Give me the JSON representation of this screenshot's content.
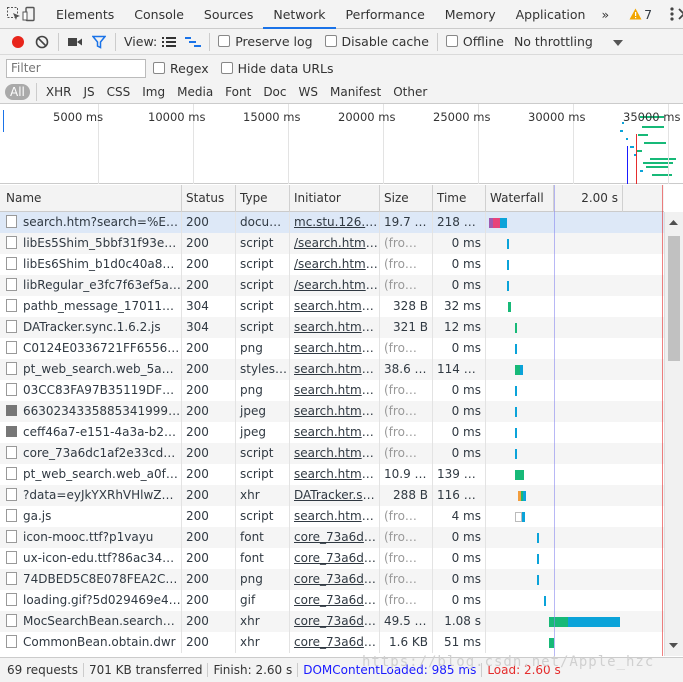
{
  "tabs": {
    "items": [
      "Elements",
      "Console",
      "Sources",
      "Network",
      "Performance",
      "Memory",
      "Application"
    ],
    "more": "»",
    "warnings": "7"
  },
  "toolbar": {
    "view_label": "View:",
    "preserve_log": "Preserve log",
    "disable_cache": "Disable cache",
    "offline": "Offline",
    "throttling": "No throttling"
  },
  "filter": {
    "placeholder": "Filter",
    "regex": "Regex",
    "hide_data_urls": "Hide data URLs"
  },
  "types": [
    "All",
    "XHR",
    "JS",
    "CSS",
    "Img",
    "Media",
    "Font",
    "Doc",
    "WS",
    "Manifest",
    "Other"
  ],
  "overview_ticks": [
    "5000 ms",
    "10000 ms",
    "15000 ms",
    "20000 ms",
    "25000 ms",
    "30000 ms",
    "35000 ms"
  ],
  "columns": {
    "name": "Name",
    "status": "Status",
    "type": "Type",
    "initiator": "Initiator",
    "size": "Size",
    "time": "Time",
    "waterfall": "Waterfall",
    "wf_tick": "2.00 s"
  },
  "rows": [
    {
      "name": "search.htm?search=%E8%A...",
      "icon": "file",
      "status": "200",
      "type": "docum...",
      "initiator": "mc.stu.126.ne...",
      "size": "19.7 KB",
      "time": "218 ms",
      "size_gray": false,
      "wf": [
        {
          "from": 0.0,
          "to": 0.025,
          "color": "#a05ab0"
        },
        {
          "from": 0.025,
          "to": 0.06,
          "color": "#e8437a"
        },
        {
          "from": 0.06,
          "to": 0.105,
          "color": "#0ba3d9"
        }
      ]
    },
    {
      "name": "libEs5Shim_5bbf31f93e60b1...",
      "icon": "file",
      "status": "200",
      "type": "script",
      "initiator": "/search.htm?s...",
      "size": "(from ...",
      "time": "0 ms",
      "size_gray": true,
      "wf": [
        {
          "from": 0.105,
          "to": 0.115,
          "color": "#0ba3d9"
        }
      ]
    },
    {
      "name": "libEs6Shim_b1d0c40a89ec7...",
      "icon": "file",
      "status": "200",
      "type": "script",
      "initiator": "/search.htm?s...",
      "size": "(from ...",
      "time": "0 ms",
      "size_gray": true,
      "wf": [
        {
          "from": 0.105,
          "to": 0.115,
          "color": "#0ba3d9"
        }
      ]
    },
    {
      "name": "libRegular_e3fc7f63ef5a597...",
      "icon": "file",
      "status": "200",
      "type": "script",
      "initiator": "/search.htm?s...",
      "size": "(from ...",
      "time": "0 ms",
      "size_gray": true,
      "wf": [
        {
          "from": 0.105,
          "to": 0.115,
          "color": "#0ba3d9"
        }
      ]
    },
    {
      "name": "pathb_message_17011101.js",
      "icon": "file",
      "status": "304",
      "type": "script",
      "initiator": "search.htm?s...",
      "size": "328 B",
      "time": "32 ms",
      "size_gray": false,
      "wf": [
        {
          "from": 0.11,
          "to": 0.125,
          "color": "#17b978"
        }
      ]
    },
    {
      "name": "DATracker.sync.1.6.2.js",
      "icon": "file",
      "status": "304",
      "type": "script",
      "initiator": "search.htm?s...",
      "size": "321 B",
      "time": "12 ms",
      "size_gray": false,
      "wf": [
        {
          "from": 0.15,
          "to": 0.16,
          "color": "#17b978"
        }
      ]
    },
    {
      "name": "C0124E0336721FF65563B76...",
      "icon": "file",
      "status": "200",
      "type": "png",
      "initiator": "search.htm?s...",
      "size": "(from ...",
      "time": "0 ms",
      "size_gray": true,
      "wf": [
        {
          "from": 0.15,
          "to": 0.16,
          "color": "#0ba3d9"
        }
      ]
    },
    {
      "name": "pt_web_search.web_5abea0...",
      "icon": "file",
      "status": "200",
      "type": "stylesh...",
      "initiator": "search.htm?s...",
      "size": "38.6 KB",
      "time": "114 ms",
      "size_gray": false,
      "wf": [
        {
          "from": 0.15,
          "to": 0.175,
          "color": "#17b978"
        },
        {
          "from": 0.175,
          "to": 0.195,
          "color": "#0ba3d9"
        }
      ]
    },
    {
      "name": "03CC83FA97B35119DFB8C77...",
      "icon": "file",
      "status": "200",
      "type": "png",
      "initiator": "search.htm?s...",
      "size": "(from ...",
      "time": "0 ms",
      "size_gray": true,
      "wf": [
        {
          "from": 0.15,
          "to": 0.16,
          "color": "#0ba3d9"
        }
      ]
    },
    {
      "name": "6630234335885341999.png",
      "icon": "image",
      "status": "200",
      "type": "jpeg",
      "initiator": "search.htm?s...",
      "size": "(from ...",
      "time": "0 ms",
      "size_gray": true,
      "wf": [
        {
          "from": 0.15,
          "to": 0.16,
          "color": "#0ba3d9"
        }
      ]
    },
    {
      "name": "ceff46a7-e151-4a3a-b208-9...",
      "icon": "image",
      "status": "200",
      "type": "jpeg",
      "initiator": "search.htm?s...",
      "size": "(from ...",
      "time": "0 ms",
      "size_gray": true,
      "wf": [
        {
          "from": 0.15,
          "to": 0.16,
          "color": "#0ba3d9"
        }
      ]
    },
    {
      "name": "core_73a6dc1af2e33cd704...",
      "icon": "file",
      "status": "200",
      "type": "script",
      "initiator": "search.htm?s...",
      "size": "(from ...",
      "time": "0 ms",
      "size_gray": true,
      "wf": [
        {
          "from": 0.15,
          "to": 0.16,
          "color": "#0ba3d9"
        }
      ]
    },
    {
      "name": "pt_web_search.web_a0f2f0f...",
      "icon": "file",
      "status": "200",
      "type": "script",
      "initiator": "search.htm?s...",
      "size": "10.9 KB",
      "time": "139 ms",
      "size_gray": false,
      "wf": [
        {
          "from": 0.15,
          "to": 0.2,
          "color": "#17b978"
        }
      ]
    },
    {
      "name": "?data=eyJkYXRhVHlwZSI6IC...",
      "icon": "file",
      "status": "200",
      "type": "xhr",
      "initiator": "DATracker.syn...",
      "size": "288 B",
      "time": "116 ms",
      "size_gray": false,
      "wf": [
        {
          "from": 0.165,
          "to": 0.18,
          "color": "#f29d3d"
        },
        {
          "from": 0.18,
          "to": 0.195,
          "color": "#17b978"
        },
        {
          "from": 0.195,
          "to": 0.21,
          "color": "#0ba3d9"
        }
      ]
    },
    {
      "name": "ga.js",
      "icon": "file",
      "status": "200",
      "type": "script",
      "initiator": "search.htm?s...",
      "size": "(from ...",
      "time": "4 ms",
      "size_gray": true,
      "wf": [
        {
          "from": 0.15,
          "to": 0.19,
          "color": "#cfcfcf"
        },
        {
          "from": 0.19,
          "to": 0.205,
          "color": "#0ba3d9"
        }
      ]
    },
    {
      "name": "icon-mooc.ttf?p1vayu",
      "icon": "file",
      "status": "200",
      "type": "font",
      "initiator": "core_73a6dc1...",
      "size": "(from ...",
      "time": "0 ms",
      "size_gray": true,
      "wf": [
        {
          "from": 0.27,
          "to": 0.28,
          "color": "#0ba3d9"
        }
      ]
    },
    {
      "name": "ux-icon-edu.ttf?86ac34de8...",
      "icon": "file",
      "status": "200",
      "type": "font",
      "initiator": "core_73a6dc1...",
      "size": "(from ...",
      "time": "0 ms",
      "size_gray": true,
      "wf": [
        {
          "from": 0.27,
          "to": 0.28,
          "color": "#0ba3d9"
        }
      ]
    },
    {
      "name": "74DBED5C8E078FEA2C54FD...",
      "icon": "file",
      "status": "200",
      "type": "png",
      "initiator": "core_73a6dc1...",
      "size": "(from ...",
      "time": "0 ms",
      "size_gray": true,
      "wf": [
        {
          "from": 0.27,
          "to": 0.28,
          "color": "#0ba3d9"
        }
      ]
    },
    {
      "name": "loading.gif?5d029469e4646...",
      "icon": "file",
      "status": "200",
      "type": "gif",
      "initiator": "core_73a6dc1...",
      "size": "(from ...",
      "time": "0 ms",
      "size_gray": true,
      "wf": [
        {
          "from": 0.31,
          "to": 0.32,
          "color": "#0ba3d9"
        }
      ]
    },
    {
      "name": "MocSearchBean.searchMo...",
      "icon": "file",
      "status": "200",
      "type": "xhr",
      "initiator": "core_73a6dc1...",
      "size": "49.5 KB",
      "time": "1.08 s",
      "size_gray": false,
      "wf": [
        {
          "from": 0.34,
          "to": 0.45,
          "color": "#17b978"
        },
        {
          "from": 0.45,
          "to": 0.745,
          "color": "#0ba3d9"
        }
      ]
    },
    {
      "name": "CommonBean.obtain.dwr",
      "icon": "file",
      "status": "200",
      "type": "xhr",
      "initiator": "core_73a6dc1...",
      "size": "1.6 KB",
      "time": "51 ms",
      "size_gray": false,
      "wf": [
        {
          "from": 0.34,
          "to": 0.37,
          "color": "#17b978"
        }
      ]
    }
  ],
  "status_bar": {
    "requests": "69 requests",
    "transferred": "701 KB transferred",
    "finish": "Finish: 2.60 s",
    "dom_loaded": "DOMContentLoaded: 985 ms",
    "load": "Load: 2.60 s"
  },
  "watermark": "https://blog.csdn.net/Apple_hzc",
  "colors": {
    "record": "#e8251b",
    "filter_icon": "#1a73e8",
    "dom_loaded": "#1a1aff",
    "load": "#e52d2d",
    "selected_row": "#dde8f7",
    "warning": "#f2a600"
  }
}
